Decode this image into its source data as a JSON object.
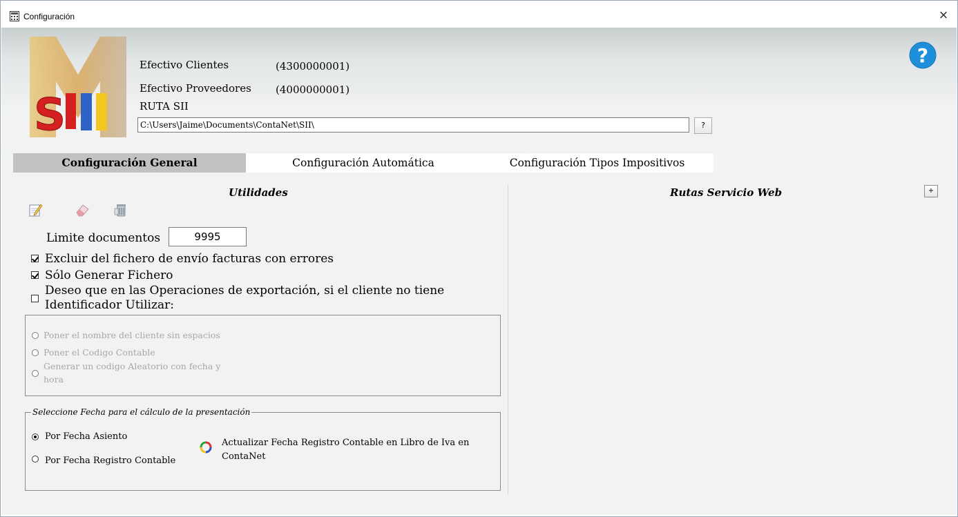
{
  "window": {
    "title": "Configuración",
    "close_glyph": "×",
    "app_icon": "calculator-icon"
  },
  "header": {
    "logo_text": "SII",
    "efectivo_clientes_label": "Efectivo Clientes",
    "efectivo_clientes_value": "(4300000001)",
    "efectivo_proveedores_label": "Efectivo Proveedores",
    "efectivo_proveedores_value": "(4000000001)",
    "ruta_label": "RUTA SII",
    "ruta_value": "C:\\Users\\Jaime\\Documents\\ContaNet\\SII\\",
    "browse_label": "?",
    "help_glyph": "?"
  },
  "tabs": [
    {
      "label": "Configuración General",
      "active": true
    },
    {
      "label": "Configuración Automática",
      "active": false
    },
    {
      "label": "Configuración Tipos Impositivos",
      "active": false
    }
  ],
  "utilidades": {
    "title": "Utilidades",
    "tools": [
      "edit-icon",
      "eraser-icon",
      "delete-icon"
    ],
    "limit_label": "Limite documentos",
    "limit_value": "9995",
    "checks": [
      {
        "label": "Excluir del fichero de envío facturas con errores",
        "checked": true
      },
      {
        "label": "Sólo Generar Fichero",
        "checked": true
      },
      {
        "label_line1": "Deseo que en las Operaciones de exportación, si el cliente no tiene",
        "label_line2": "Identificador Utilizar:",
        "checked": false
      }
    ],
    "id_options": [
      {
        "label": "Poner el nombre del cliente sin espacios",
        "enabled": false
      },
      {
        "label": "Poner el Codigo Contable",
        "enabled": false
      },
      {
        "label_line1": "Generar un codigo Aleatorio con fecha y",
        "label_line2": "hora",
        "enabled": false
      }
    ]
  },
  "fecha": {
    "legend": "Seleccione Fecha para el cálculo de la presentación",
    "options": [
      {
        "label": "Por Fecha Asiento",
        "selected": true
      },
      {
        "label": "Por Fecha Registro Contable",
        "selected": false
      }
    ],
    "update_icon": "refresh-icon",
    "update_line1": "Actualizar Fecha Registro Contable en Libro de Iva en",
    "update_line2": "ContaNet"
  },
  "rutas": {
    "title": "Rutas Servicio Web",
    "add_label": "+"
  },
  "colors": {
    "tab_active": "#c2c2c2",
    "content_bg": "#f2f2f2",
    "help_blue": "#1e8fd8"
  }
}
